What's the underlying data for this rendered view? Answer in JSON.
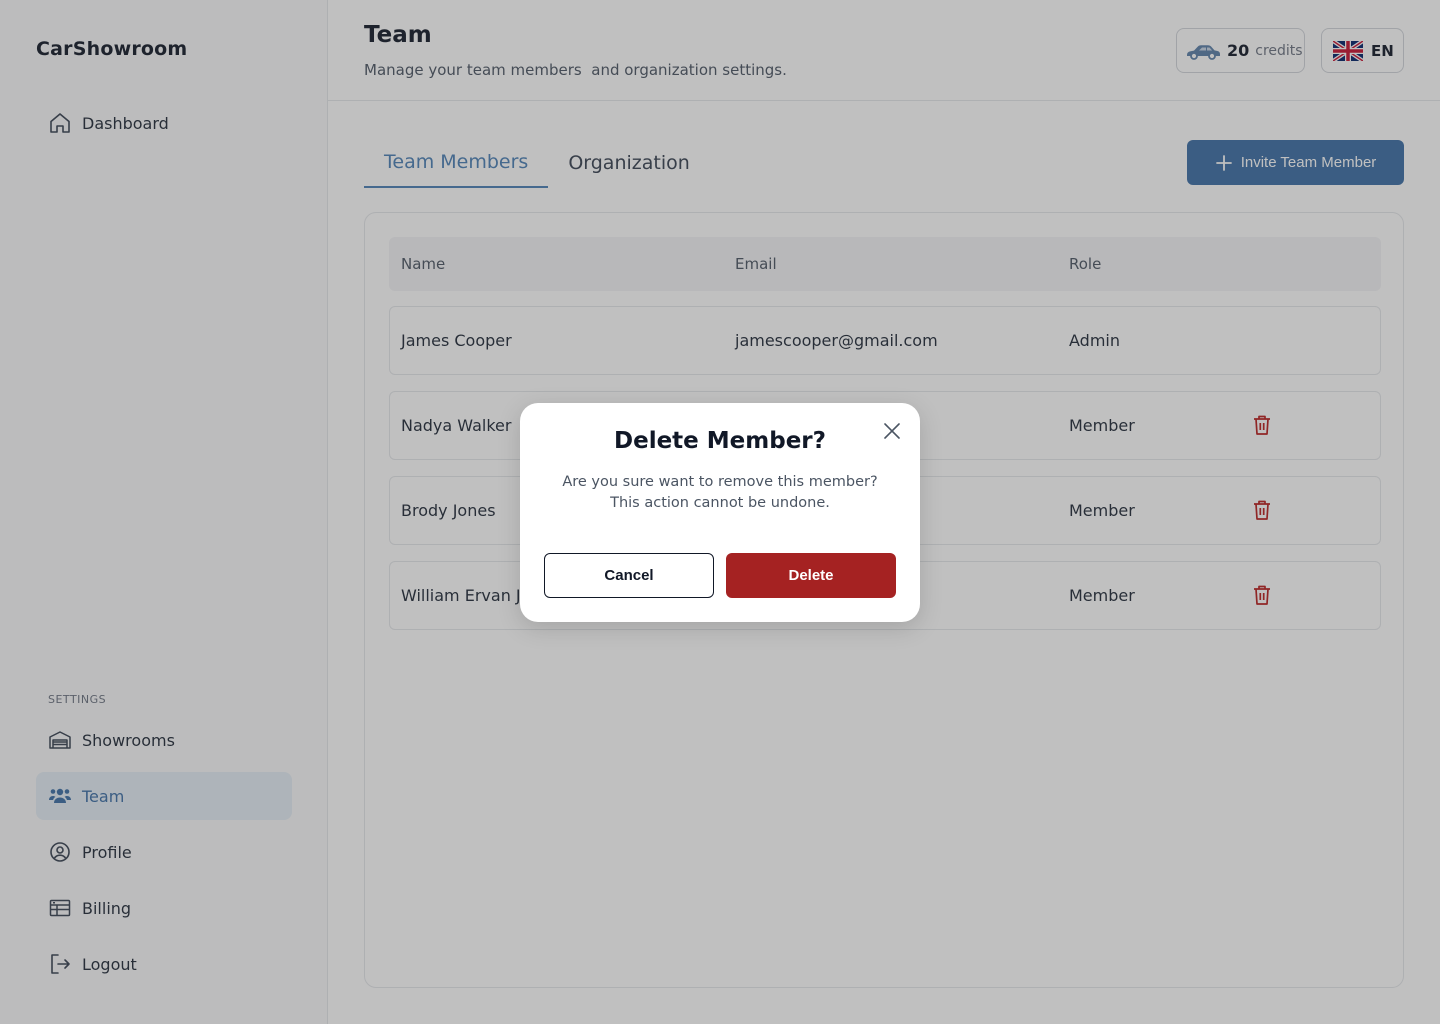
{
  "app": {
    "brand": "CarShowroom"
  },
  "sidebar": {
    "top_items": [
      {
        "label": "Dashboard",
        "icon": "home-icon"
      }
    ],
    "settings_label": "SETTINGS",
    "settings_items": [
      {
        "label": "Showrooms",
        "icon": "garage-icon"
      },
      {
        "label": "Team",
        "icon": "users-icon",
        "active": true
      },
      {
        "label": "Profile",
        "icon": "user-circle-icon"
      },
      {
        "label": "Billing",
        "icon": "billing-icon"
      },
      {
        "label": "Logout",
        "icon": "logout-icon"
      }
    ]
  },
  "header": {
    "title": "Team",
    "subtitle": "Manage your team members  and organization settings.",
    "credits": {
      "count": "20",
      "label": "credits",
      "icon": "car-icon"
    },
    "language": {
      "code": "EN",
      "icon": "uk-flag-icon"
    }
  },
  "tabs": [
    {
      "label": "Team Members",
      "active": true
    },
    {
      "label": "Organization",
      "active": false
    }
  ],
  "invite_button": {
    "label": "Invite Team Member",
    "icon": "plus-icon"
  },
  "table": {
    "columns": [
      "Name",
      "Email",
      "Role"
    ],
    "rows": [
      {
        "name": "James Cooper",
        "email": "jamescooper@gmail.com",
        "role": "Admin",
        "deletable": false
      },
      {
        "name": "Nadya Walker",
        "email": "",
        "role": "Member",
        "deletable": true
      },
      {
        "name": "Brody Jones",
        "email": "",
        "role": "Member",
        "deletable": true
      },
      {
        "name": "William Ervan Jo",
        "email": "",
        "role": "Member",
        "deletable": true
      }
    ]
  },
  "modal": {
    "title": "Delete Member?",
    "text_line1": "Are you sure want to remove this member?",
    "text_line2": "This action cannot be undone.",
    "cancel_label": "Cancel",
    "delete_label": "Delete"
  },
  "colors": {
    "accent": "#3b6ea5",
    "danger": "#a52222",
    "active_nav_bg": "#e5edf6"
  }
}
